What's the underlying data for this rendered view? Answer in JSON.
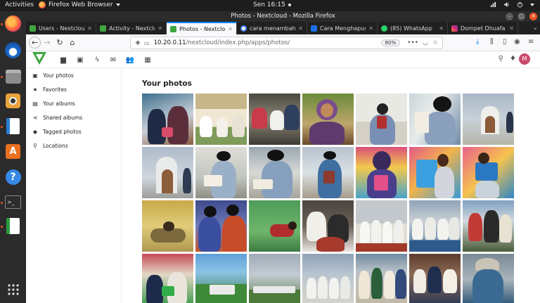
{
  "topbar": {
    "activities": "Activities",
    "app_menu": "Firefox Web Browser",
    "clock": "Sen 16:15"
  },
  "window": {
    "title": "Photos - Nextcloud - Mozilla Firefox"
  },
  "tabs": [
    {
      "label": "Users - Nextcloud",
      "favicon_color": "#3fa63f",
      "active": false
    },
    {
      "label": "Activity - Nextclou",
      "favicon_color": "#3fa63f",
      "active": false
    },
    {
      "label": "Photos - Nextcloud",
      "favicon_color": "#3fa63f",
      "active": true
    },
    {
      "label": "cara menambah p",
      "favicon_color": "#4285f4",
      "active": false
    },
    {
      "label": "Cara Menghapus",
      "favicon_color": "#1a73e8",
      "active": false
    },
    {
      "label": "(85) WhatsApp",
      "favicon_color": "#25d366",
      "active": false
    },
    {
      "label": "Dompet Dhuafa P",
      "favicon_color": "#d6249f",
      "active": false
    }
  ],
  "urlbar": {
    "host": "10.20.0.11",
    "path": "/nextcloud/index.php/apps/photos/",
    "zoom": "80%"
  },
  "nextcloud": {
    "avatar_letter": "M",
    "nav": [
      {
        "label": "Your photos",
        "icon": "image-icon"
      },
      {
        "label": "Favorites",
        "icon": "star-icon"
      },
      {
        "label": "Your albums",
        "icon": "album-icon"
      },
      {
        "label": "Shared albums",
        "icon": "share-icon"
      },
      {
        "label": "Tagged photos",
        "icon": "tag-icon"
      },
      {
        "label": "Locations",
        "icon": "map-marker-icon"
      }
    ],
    "page_title": "Your photos"
  },
  "colors": {
    "accent": "#0a84ff",
    "ubuntu_orange": "#e95420",
    "nextcloud_green": "#3fa63f"
  }
}
